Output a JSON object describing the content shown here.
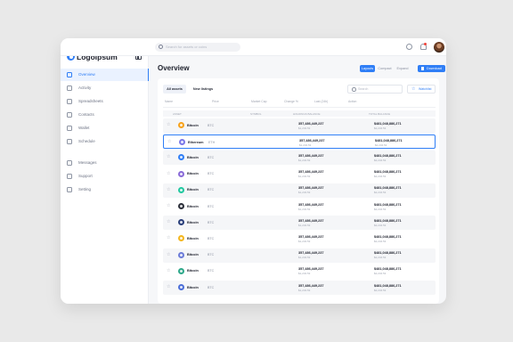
{
  "app": {
    "logo_text": "Logoipsum"
  },
  "topbar": {
    "search_placeholder": "Search for assets or coins"
  },
  "page": {
    "title": "Overview"
  },
  "sidebar": {
    "items": [
      {
        "label": "Overview",
        "icon": "grid-icon",
        "active": true
      },
      {
        "label": "Activity",
        "icon": "activity-icon"
      },
      {
        "label": "Spreadsheets",
        "icon": "spreadsheet-icon"
      },
      {
        "label": "Contacts",
        "icon": "contacts-icon"
      },
      {
        "label": "Wallet",
        "icon": "wallet-icon"
      },
      {
        "label": "Schedule",
        "icon": "calendar-icon"
      },
      {
        "label": "Messages",
        "icon": "message-icon"
      },
      {
        "label": "Support",
        "icon": "support-icon"
      },
      {
        "label": "Setting",
        "icon": "gear-icon"
      }
    ]
  },
  "view_toggle": {
    "options": [
      "Layouts",
      "Compact",
      "Expand"
    ],
    "selected": "Layouts"
  },
  "download_label": "Download",
  "tabs": [
    "All assets",
    "New listings"
  ],
  "card_search_placeholder": "Search",
  "watchlist_label": "Watchlist",
  "filters": [
    "Name",
    "Price",
    "Market Cap",
    "Change %",
    "Last (24h)",
    "Action"
  ],
  "table": {
    "headers": [
      "ASSET",
      "SYMBOL",
      "HOLDINGS BALANCE",
      "TOTAL BALANCE"
    ],
    "rows": [
      {
        "name": "Bitcoin",
        "symbol": "BTC",
        "balance": "357,486,449,237",
        "balance_sub": "$1,234.53",
        "total": "$481,048,886,271",
        "total_sub": "$2,234.53",
        "color": "#f7a21b"
      },
      {
        "name": "Ethereum",
        "symbol": "ETH",
        "balance": "357,486,449,237",
        "balance_sub": "$1,234.53",
        "total": "$481,048,886,271",
        "total_sub": "$2,234.53",
        "color": "#7b78e8"
      },
      {
        "name": "Bitcoin",
        "symbol": "BTC",
        "balance": "357,486,449,237",
        "balance_sub": "$1,234.53",
        "total": "$481,048,886,271",
        "total_sub": "$2,234.53",
        "color": "#2f7ef6"
      },
      {
        "name": "Bitcoin",
        "symbol": "BTC",
        "balance": "357,486,449,237",
        "balance_sub": "$1,234.53",
        "total": "$481,048,886,271",
        "total_sub": "$2,234.53",
        "color": "#8a6bd8"
      },
      {
        "name": "Bitcoin",
        "symbol": "BTC",
        "balance": "357,486,449,237",
        "balance_sub": "$1,234.53",
        "total": "$481,048,886,271",
        "total_sub": "$2,234.53",
        "color": "#22c8a0"
      },
      {
        "name": "Bitcoin",
        "symbol": "BTC",
        "balance": "357,486,449,237",
        "balance_sub": "$1,234.53",
        "total": "$481,048,886,271",
        "total_sub": "$2,234.53",
        "color": "#2c2f3a"
      },
      {
        "name": "Bitcoin",
        "symbol": "BTC",
        "balance": "357,486,449,237",
        "balance_sub": "$1,234.53",
        "total": "$481,048,886,271",
        "total_sub": "$2,234.53",
        "color": "#2a3f7a"
      },
      {
        "name": "Bitcoin",
        "symbol": "BTC",
        "balance": "357,486,449,237",
        "balance_sub": "$1,234.53",
        "total": "$481,048,886,271",
        "total_sub": "$2,234.53",
        "color": "#f4b71f"
      },
      {
        "name": "Bitcoin",
        "symbol": "BTC",
        "balance": "357,486,449,237",
        "balance_sub": "$1,234.53",
        "total": "$481,048,886,271",
        "total_sub": "$2,234.53",
        "color": "#6c7cd8"
      },
      {
        "name": "Bitcoin",
        "symbol": "BTC",
        "balance": "357,486,449,237",
        "balance_sub": "$1,234.53",
        "total": "$481,048,886,271",
        "total_sub": "$2,234.53",
        "color": "#2ea88a"
      },
      {
        "name": "Bitcoin",
        "symbol": "BTC",
        "balance": "357,486,449,237",
        "balance_sub": "$1,234.53",
        "total": "$481,048,886,271",
        "total_sub": "$2,234.53",
        "color": "#4b6ed8"
      }
    ]
  },
  "colors": {
    "accent": "#2f7ef6",
    "background": "#e9e9e9"
  }
}
